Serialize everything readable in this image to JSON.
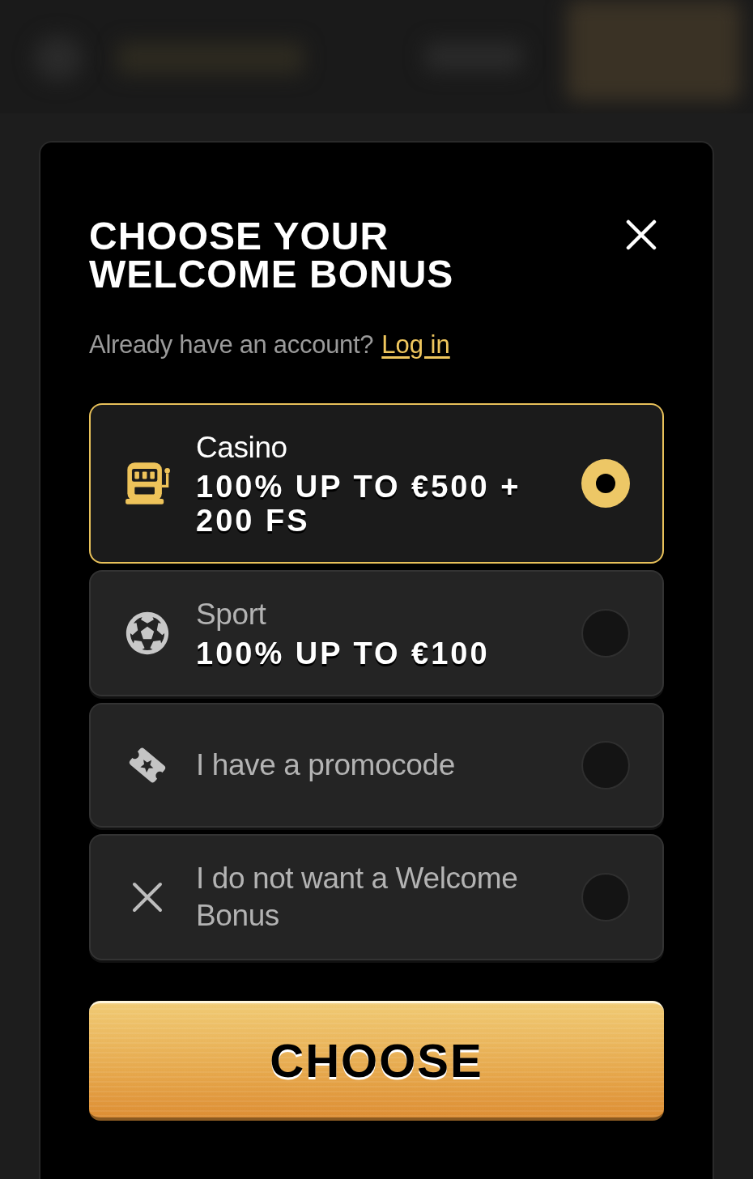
{
  "modal": {
    "title": "CHOOSE YOUR WELCOME BONUS",
    "account_prompt": "Already have an account?",
    "login_link": "Log in"
  },
  "options": [
    {
      "kind": "casino",
      "title": "Casino",
      "bonus": "100% UP TO €500 + 200 FS",
      "selected": true
    },
    {
      "kind": "sport",
      "title": "Sport",
      "bonus": "100% UP TO €100",
      "selected": false
    },
    {
      "kind": "promocode",
      "title": "I have a promocode",
      "selected": false
    },
    {
      "kind": "no_bonus",
      "title": "I do not want a Welcome Bonus",
      "selected": false
    }
  ],
  "choose_button": "CHOOSE"
}
